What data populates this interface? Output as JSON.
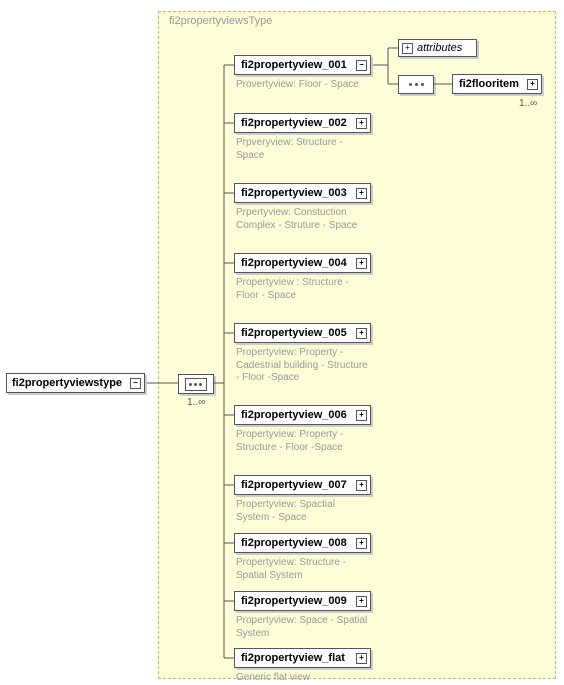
{
  "container_label": "fi2propertyviewsType",
  "root": {
    "label": "fi2propertyviewstype",
    "multiplicity": "1..∞"
  },
  "nodes": [
    {
      "label": "fi2propertyview_001",
      "desc": "Provertyview: Floor - Space"
    },
    {
      "label": "fi2propertyview_002",
      "desc": "Prpveryview: Structure - Space"
    },
    {
      "label": "fi2propertyview_003",
      "desc": "Prpertyview: Constuction Complex - Struture - Space"
    },
    {
      "label": "fi2propertyview_004",
      "desc": "Propertyview : Structure - Floor - Space"
    },
    {
      "label": "fi2propertyview_005",
      "desc": "Propertyview: Property - Cadestrial building - Structure - Floor -Space"
    },
    {
      "label": "fi2propertyview_006",
      "desc": "Propertyview: Property - Structure - Floor -Space"
    },
    {
      "label": "fi2propertyview_007",
      "desc": "Propertyview: Spactial System - Space"
    },
    {
      "label": "fi2propertyview_008",
      "desc": "Propertyview: Structure - Spatial System"
    },
    {
      "label": "fi2propertyview_009",
      "desc": "Propertyview: Space - Spatial System"
    },
    {
      "label": "fi2propertyview_flat",
      "desc": "Generic flat view"
    }
  ],
  "attributes_label": "attributes",
  "flooritem": {
    "label": "fi2flooritem",
    "multiplicity": "1..∞"
  }
}
